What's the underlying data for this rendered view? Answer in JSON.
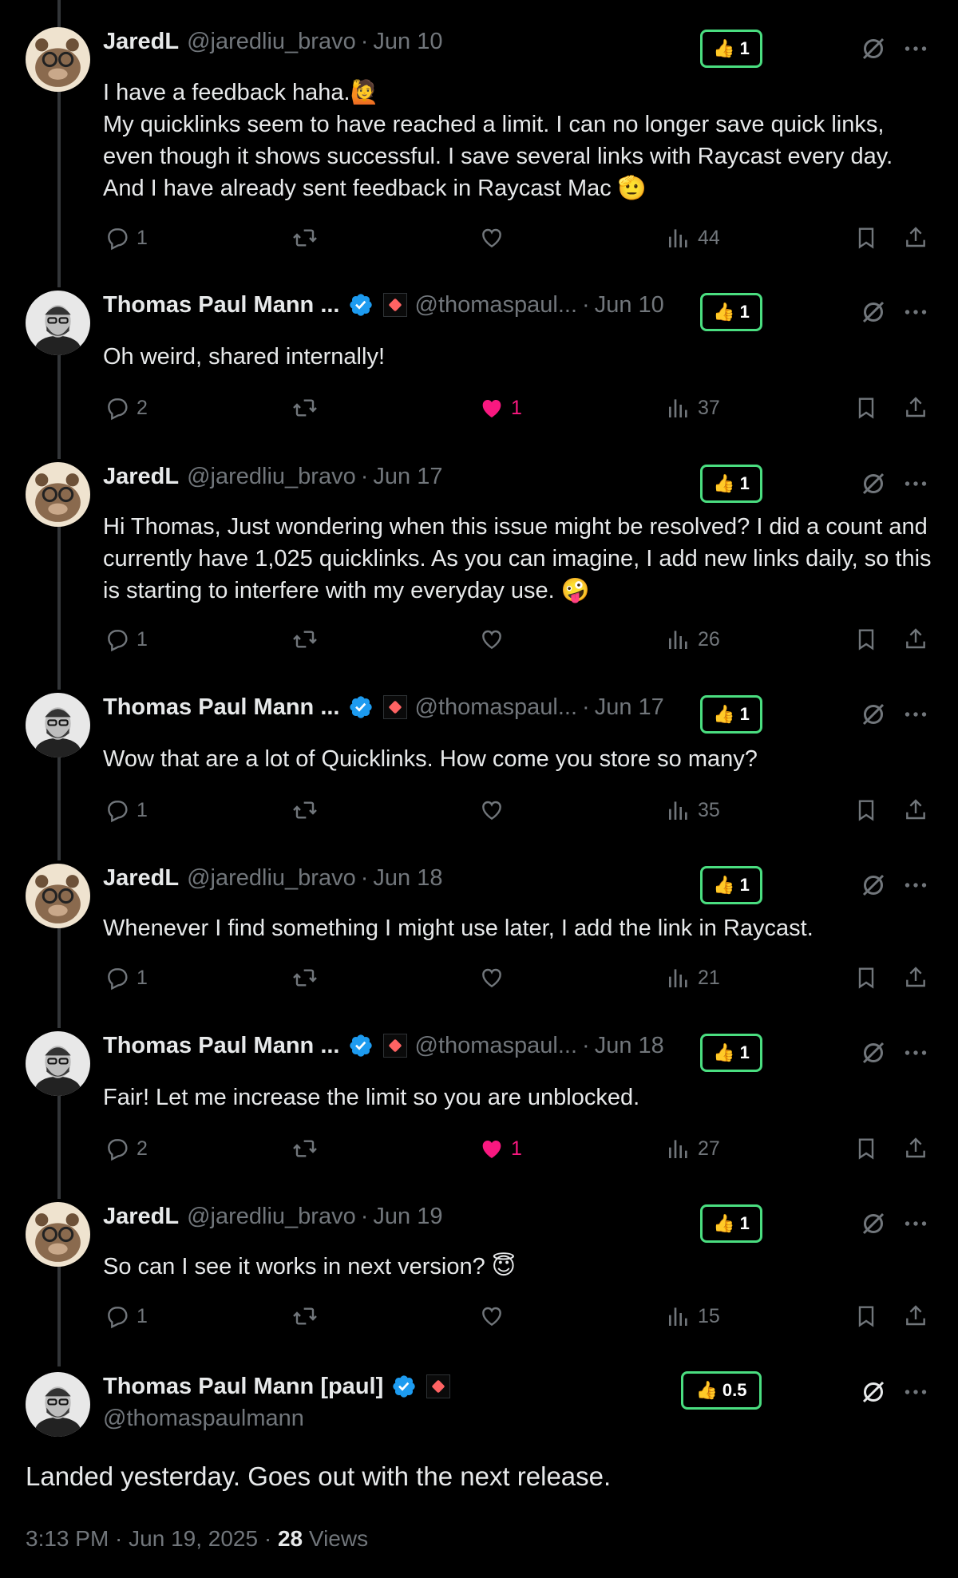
{
  "colors": {
    "accent_badge": "#4ade80",
    "like": "#f91880",
    "verified": "#1d9bf0",
    "muted": "#71767b"
  },
  "replies": [
    {
      "name": "JaredL",
      "handle": "@jaredliu_bravo",
      "dot": "·",
      "date": "Jun 10",
      "badge": "1",
      "text_lines": [
        "I have a feedback haha.🙋",
        "My quicklinks seem to have reached a limit. I can no longer save quick links, even though it shows successful. I save several links with Raycast every day. And I have already sent feedback in Raycast Mac 🫡"
      ],
      "replies": "1",
      "likes": "",
      "views": "44"
    },
    {
      "name": "Thomas Paul Mann ...",
      "handle": "@thomaspaul...",
      "dot": "·",
      "date": "Jun 10",
      "badge": "1",
      "text_lines": [
        "Oh weird, shared internally!"
      ],
      "replies": "2",
      "likes": "1",
      "views": "37"
    },
    {
      "name": "JaredL",
      "handle": "@jaredliu_bravo",
      "dot": "·",
      "date": "Jun 17",
      "badge": "1",
      "text_lines": [
        "Hi Thomas, Just wondering when this issue might be resolved? I did a count and currently have 1,025 quicklinks. As you can imagine, I add new links daily, so this is starting to interfere with my everyday use. 🤪"
      ],
      "replies": "1",
      "likes": "",
      "views": "26"
    },
    {
      "name": "Thomas Paul Mann ...",
      "handle": "@thomaspaul...",
      "dot": "·",
      "date": "Jun 17",
      "badge": "1",
      "text_lines": [
        "Wow that are a lot of Quicklinks. How come you store so many?"
      ],
      "replies": "1",
      "likes": "",
      "views": "35"
    },
    {
      "name": "JaredL",
      "handle": "@jaredliu_bravo",
      "dot": "·",
      "date": "Jun 18",
      "badge": "1",
      "text_lines": [
        "Whenever I find something I might use later, I add the link in Raycast."
      ],
      "replies": "1",
      "likes": "",
      "views": "21"
    },
    {
      "name": "Thomas Paul Mann ...",
      "handle": "@thomaspaul...",
      "dot": "·",
      "date": "Jun 18",
      "badge": "1",
      "text_lines": [
        "Fair! Let me increase the limit so you are unblocked."
      ],
      "replies": "2",
      "likes": "1",
      "views": "27"
    },
    {
      "name": "JaredL",
      "handle": "@jaredliu_bravo",
      "dot": "·",
      "date": "Jun 19",
      "badge": "1",
      "text_lines": [
        "So can I see it works in next version? 😇"
      ],
      "replies": "1",
      "likes": "",
      "views": "15"
    }
  ],
  "main": {
    "name": "Thomas Paul Mann [paul]",
    "handle": "@thomaspaulmann",
    "badge": "0.5",
    "text": "Landed yesterday. Goes out with the next release.",
    "time": "3:13 PM · Jun 19, 2025 · ",
    "views_count": "28",
    "views_label": "Views"
  }
}
